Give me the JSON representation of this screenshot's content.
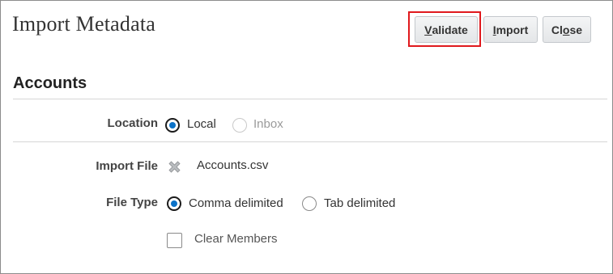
{
  "header": {
    "title": "Import Metadata",
    "buttons": {
      "validate": {
        "mnemonic": "V",
        "rest": "alidate"
      },
      "import": {
        "mnemonic": "I",
        "rest": "mport"
      },
      "close": {
        "pre": "Cl",
        "mnemonic": "o",
        "rest": "se"
      }
    }
  },
  "section": {
    "title": "Accounts"
  },
  "location": {
    "label": "Location",
    "options": [
      {
        "label": "Local",
        "selected": true,
        "enabled": true
      },
      {
        "label": "Inbox",
        "selected": false,
        "enabled": false
      }
    ]
  },
  "import_file": {
    "label": "Import File",
    "file_name": "Accounts.csv",
    "remove_icon": "remove-x-icon"
  },
  "file_type": {
    "label": "File Type",
    "options": [
      {
        "label": "Comma delimited",
        "selected": true
      },
      {
        "label": "Tab delimited",
        "selected": false
      }
    ]
  },
  "clear_members": {
    "label": "Clear Members",
    "checked": false
  },
  "colors": {
    "highlight": "#e0191d",
    "radio_dot": "#0b72c8"
  }
}
